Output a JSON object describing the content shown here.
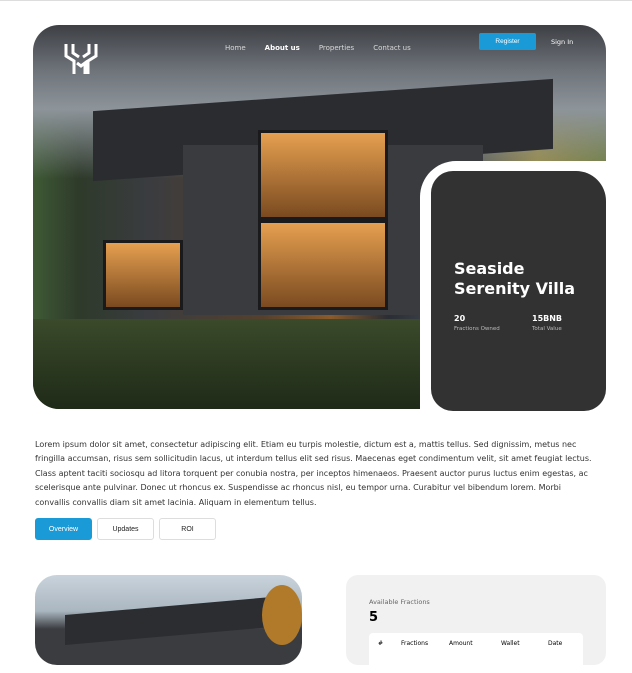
{
  "nav": {
    "items": [
      "Home",
      "About us",
      "Properties",
      "Contact us"
    ],
    "active": "About us",
    "register": "Register",
    "signin": "Sign In"
  },
  "property": {
    "title_line1": "Seaside",
    "title_line2": "Serenity Villa",
    "fractions_owned": "20",
    "fractions_owned_label": "Fractions Owned",
    "total_value": "15BNB",
    "total_value_label": "Total Value"
  },
  "description": "Lorem ipsum dolor sit amet, consectetur adipiscing elit. Etiam eu turpis molestie, dictum est a, mattis tellus. Sed dignissim, metus nec fringilla accumsan, risus sem sollicitudin lacus, ut interdum tellus elit sed risus. Maecenas eget condimentum velit, sit amet feugiat lectus. Class aptent taciti sociosqu ad litora torquent per conubia nostra, per inceptos himenaeos. Praesent auctor purus luctus enim egestas, ac scelerisque ante pulvinar. Donec ut rhoncus ex. Suspendisse ac rhoncus nisl, eu tempor urna. Curabitur vel bibendum lorem. Morbi convallis convallis diam sit amet lacinia. Aliquam in elementum tellus.",
  "tabs": [
    "Overview",
    "Updates",
    "ROI"
  ],
  "active_tab": "Overview",
  "fractions": {
    "label": "Available Fractions",
    "value": "5",
    "columns": [
      "#",
      "Fractions",
      "Amount",
      "Wallet",
      "Date"
    ]
  },
  "colors": {
    "accent": "#1a9bd7",
    "card": "#323232"
  }
}
